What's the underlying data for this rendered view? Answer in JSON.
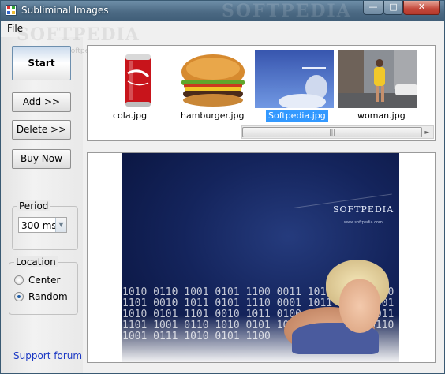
{
  "window": {
    "title": "Subliminal Images",
    "watermark": "SOFTPEDIA",
    "controls": {
      "minimize": "—",
      "maximize": "□",
      "close": "✕"
    }
  },
  "menu": {
    "file": "File",
    "watermark": "SOFTPEDIA",
    "watermark_url": "www.softpedia.com"
  },
  "sidebar": {
    "start": "Start",
    "add": "Add    >>",
    "delete": "Delete >>",
    "buy": "Buy Now",
    "period": {
      "legend": "Period",
      "value": "300 ms"
    },
    "location": {
      "legend": "Location",
      "options": [
        {
          "label": "Center",
          "selected": false
        },
        {
          "label": "Random",
          "selected": true
        }
      ]
    },
    "support": "Support forum"
  },
  "files": [
    {
      "name": "cola.jpg",
      "selected": false
    },
    {
      "name": "hamburger.jpg",
      "selected": false
    },
    {
      "name": "Softpedia.jpg",
      "selected": true
    },
    {
      "name": "woman.jpg",
      "selected": false
    }
  ],
  "scrollbar": {
    "grip": "|||",
    "arrow": "►"
  },
  "preview": {
    "logo": "SOFTPEDIA",
    "url": "www.softpedia.com"
  },
  "colors": {
    "selection": "#3399ff",
    "link": "#1b38c4",
    "titlebar": "#4c6a84"
  }
}
